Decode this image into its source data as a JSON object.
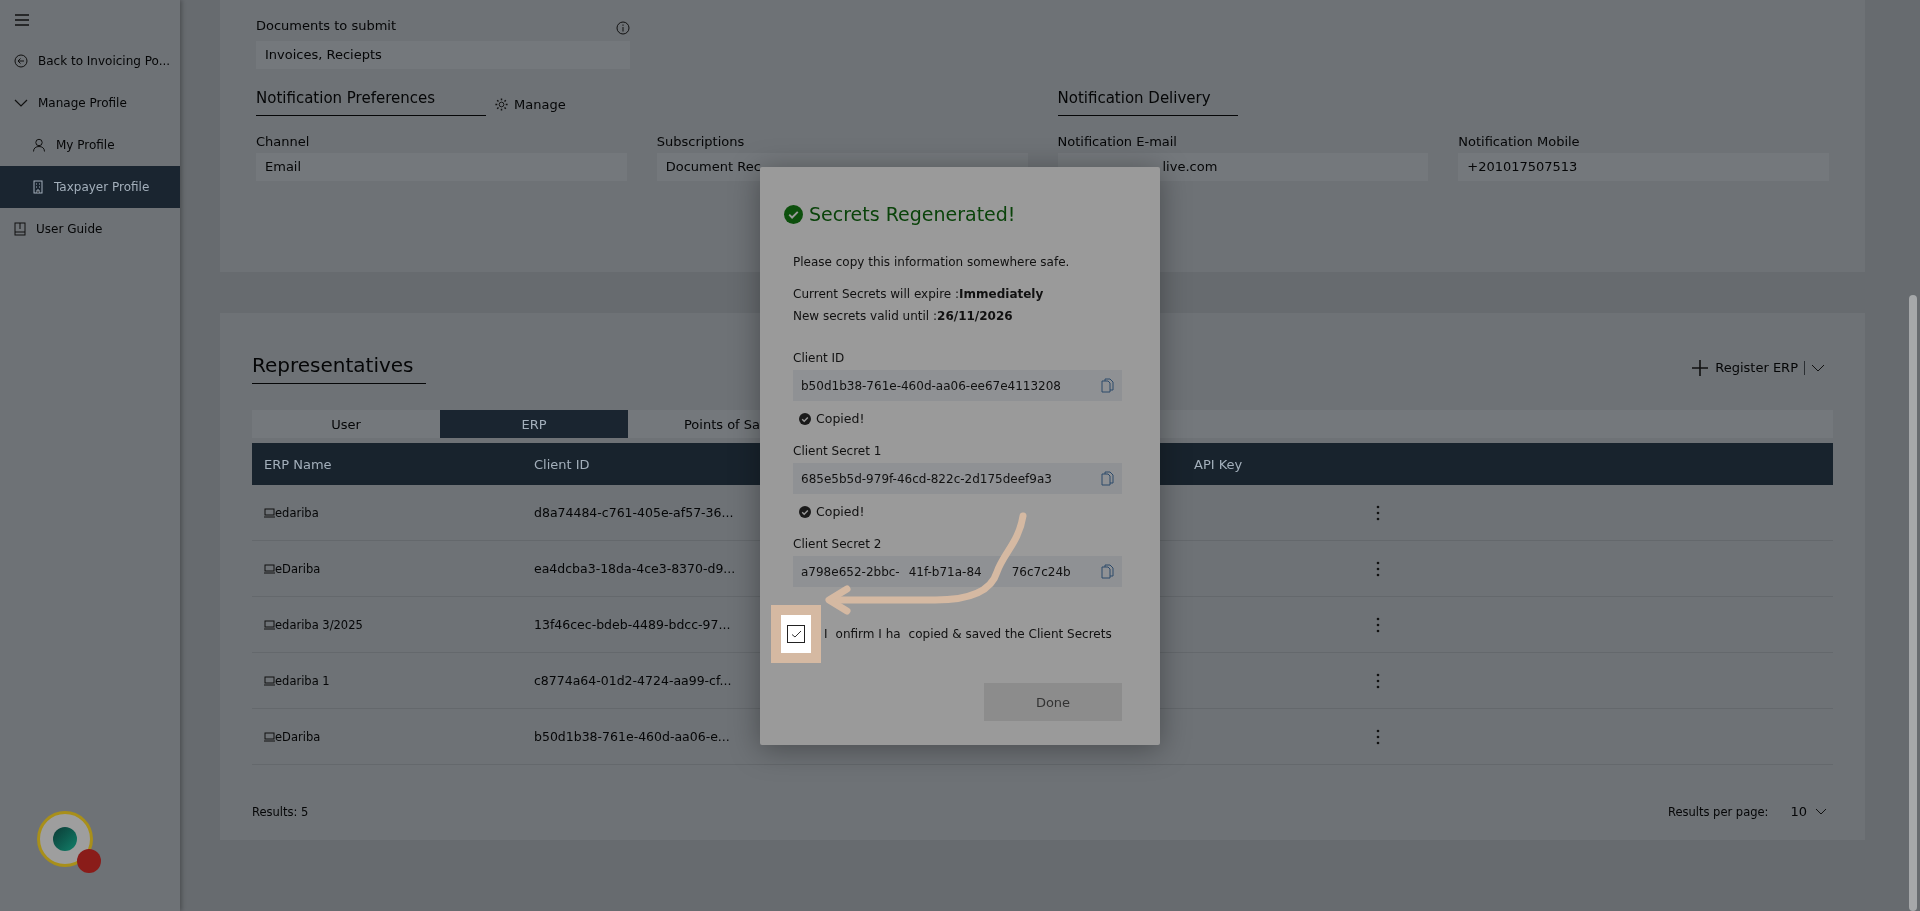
{
  "sidebar": {
    "items": [
      {
        "label": "Back to Invoicing Po...",
        "selected": false
      },
      {
        "label": "Manage Profile",
        "selected": false,
        "expanded": true,
        "children": [
          {
            "label": "My Profile",
            "selected": false
          },
          {
            "label": "Taxpayer Profile",
            "selected": true
          }
        ]
      },
      {
        "label": "User Guide",
        "selected": false
      }
    ]
  },
  "profile": {
    "documents": {
      "label": "Documents to submit",
      "value": "Invoices, Reciepts"
    },
    "preferences_title": "Notification Preferences",
    "manage": "Manage",
    "delivery_title": "Notification Delivery",
    "fields": [
      {
        "label": "Channel",
        "value": "Email"
      },
      {
        "label": "Subscriptions",
        "value": "Document Rec"
      },
      {
        "label": "Notification E-mail",
        "value": "live.com"
      },
      {
        "label": "Notification Mobile",
        "value": "+201017507513"
      }
    ]
  },
  "representatives": {
    "title": "Representatives",
    "register": "Register ERP",
    "tabs": [
      {
        "label": "User",
        "selected": false
      },
      {
        "label": "ERP",
        "selected": true
      },
      {
        "label": "Points of Sa",
        "selected": false
      }
    ],
    "columns": [
      "ERP Name",
      "Client ID",
      "API Key"
    ],
    "rows": [
      {
        "name": "edariba",
        "client_id": "d8a74484-c761-405e-af57-36..."
      },
      {
        "name": "eDariba",
        "client_id": "ea4dcba3-18da-4ce3-8370-d9..."
      },
      {
        "name": "edariba 3/2025",
        "client_id": "13f46cec-bdeb-4489-bdcc-97..."
      },
      {
        "name": "edariba 1",
        "client_id": "c8774a64-01d2-4724-aa99-cf..."
      },
      {
        "name": "eDariba",
        "client_id": "b50d1b38-761e-460d-aa06-e..."
      }
    ],
    "results": "Results: 5",
    "per_page_label": "Results per page:",
    "per_page": "10"
  },
  "dialog": {
    "title": "Secrets Regenerated!",
    "intro": "Please copy this information somewhere safe.",
    "expire": "Current Secrets will expire :**Immediately**",
    "valid": "New secrets valid until :**26/11/2026**",
    "secrets": [
      {
        "label": "Client ID",
        "value_parts": [
          "b50d1b38-761e-460d-aa06-ee67e4113208"
        ],
        "copied": "Copied!"
      },
      {
        "label": "Client Secret 1",
        "value_parts": [
          "685e5b5d-979f-46cd-822c-2d175deef9a3"
        ],
        "copied": "Copied!"
      },
      {
        "label": "Client Secret 2",
        "value_parts": [
          "a798e652-2bbc-",
          "41f-b71a-84",
          "76c7c24b"
        ]
      }
    ],
    "confirm": {
      "checked": true,
      "label_parts": [
        "I",
        "onfirm I ha",
        "copied & saved the Client Secrets"
      ]
    },
    "done": {
      "label": "Done",
      "disabled": true
    }
  }
}
